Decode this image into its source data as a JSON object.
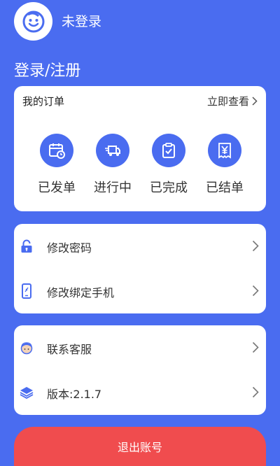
{
  "user": {
    "avatar_icon": "smiley-face-icon",
    "name": "未登录"
  },
  "login_link": "登录/注册",
  "orders": {
    "title": "我的订单",
    "view_all": "立即查看",
    "items": [
      {
        "label": "已发单",
        "icon": "calendar-clock-icon"
      },
      {
        "label": "进行中",
        "icon": "delivery-truck-icon"
      },
      {
        "label": "已完成",
        "icon": "clipboard-check-icon"
      },
      {
        "label": "已结单",
        "icon": "yen-receipt-icon"
      }
    ]
  },
  "settings": [
    {
      "label": "修改密码",
      "icon": "lock-icon"
    },
    {
      "label": "修改绑定手机",
      "icon": "phone-icon"
    }
  ],
  "support": [
    {
      "label": "联系客服",
      "icon": "customer-service-icon"
    },
    {
      "label": "版本:2.1.7",
      "icon": "layers-icon"
    }
  ],
  "logout": "退出账号",
  "colors": {
    "primary": "#4a6cf0",
    "danger": "#f04c4e",
    "card": "#ffffff"
  }
}
